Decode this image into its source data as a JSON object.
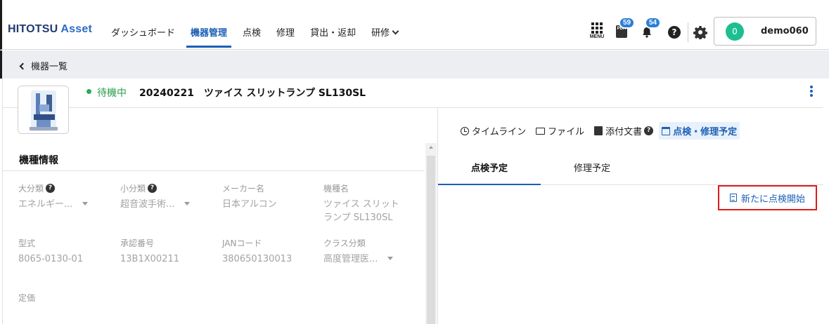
{
  "app": {
    "logo_main": "HITOTSU",
    "logo_sub": " Asset"
  },
  "nav": {
    "items": [
      {
        "label": "ダッシュボード"
      },
      {
        "label": "機器管理"
      },
      {
        "label": "点検"
      },
      {
        "label": "修理"
      },
      {
        "label": "貸出・返却"
      },
      {
        "label": "研修"
      }
    ]
  },
  "header": {
    "menu_label": "MENU",
    "pda_label": "PDA",
    "pda_badge": "59",
    "bell_badge": "54",
    "help": "?",
    "user_initial": "0",
    "username": "demo060"
  },
  "breadcrumb": {
    "back_label": "機器一覧"
  },
  "device": {
    "status": "待機中",
    "title": "20240221　ツァイス スリットランプ SL130SL"
  },
  "spec": {
    "section_title": "機種情報",
    "fields": [
      {
        "label": "大分類",
        "value": "エネルギー...",
        "has_help": true,
        "dropdown": true
      },
      {
        "label": "小分類",
        "value": "超音波手術...",
        "has_help": true,
        "dropdown": true
      },
      {
        "label": "メーカー名",
        "value": "日本アルコン"
      },
      {
        "label": "機種名",
        "value": "ツァイス スリット",
        "value2": "ランプ SL130SL"
      },
      {
        "label": "型式",
        "value": "8065-0130-01"
      },
      {
        "label": "承認番号",
        "value": "13B1X00211"
      },
      {
        "label": "JANコード",
        "value": "380650130013"
      },
      {
        "label": "クラス分類",
        "value": "高度管理医...",
        "dropdown": true
      },
      {
        "label": "定価",
        "value": ""
      }
    ]
  },
  "right": {
    "tabs": [
      {
        "label": "タイムライン"
      },
      {
        "label": "ファイル"
      },
      {
        "label": "添付文書"
      },
      {
        "label": "点検・修理予定"
      }
    ],
    "subtabs": [
      {
        "label": "点検予定"
      },
      {
        "label": "修理予定"
      }
    ],
    "new_button": "新たに点検開始"
  },
  "colors": {
    "accent": "#1b5fb5",
    "status_green": "#2eaa56",
    "highlight_red": "#e01b1b",
    "avatar": "#1dbf90"
  }
}
